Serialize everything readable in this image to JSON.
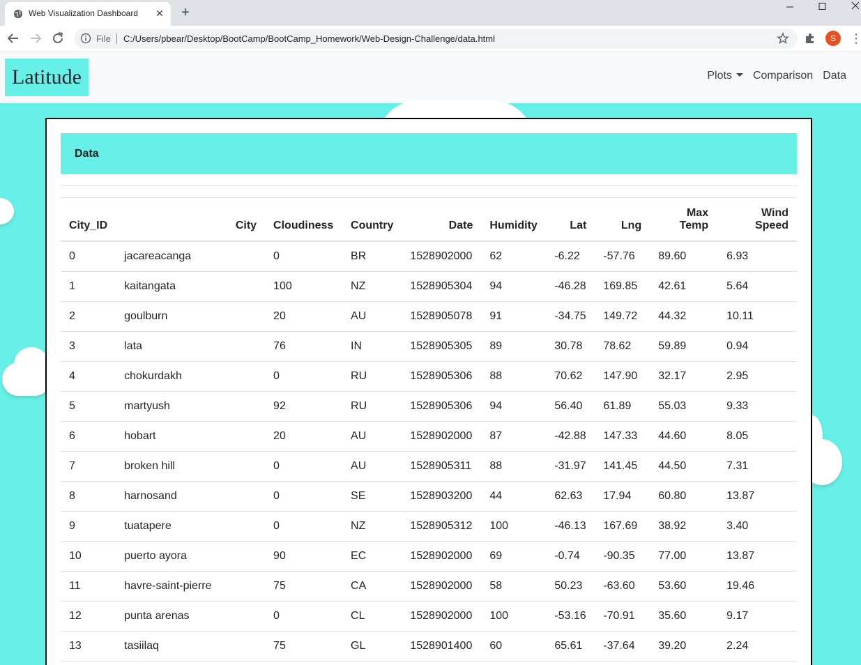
{
  "browser": {
    "tab_title": "Web Visualization Dashboard",
    "file_label": "File",
    "url": "C:/Users/pbear/Desktop/BootCamp/BootCamp_Homework/Web-Design-Challenge/data.html",
    "profile_initial": "S"
  },
  "navbar": {
    "brand": "Latitude",
    "links": [
      "Plots",
      "Comparison",
      "Data"
    ]
  },
  "panel": {
    "title": "Data"
  },
  "table": {
    "headers": [
      "City_ID",
      "City",
      "Cloudiness",
      "Country",
      "Date",
      "Humidity",
      "Lat",
      "Lng",
      "Max Temp",
      "Wind Speed"
    ],
    "rows": [
      [
        "0",
        "jacareacanga",
        "0",
        "BR",
        "1528902000",
        "62",
        "-6.22",
        "-57.76",
        "89.60",
        "6.93"
      ],
      [
        "1",
        "kaitangata",
        "100",
        "NZ",
        "1528905304",
        "94",
        "-46.28",
        "169.85",
        "42.61",
        "5.64"
      ],
      [
        "2",
        "goulburn",
        "20",
        "AU",
        "1528905078",
        "91",
        "-34.75",
        "149.72",
        "44.32",
        "10.11"
      ],
      [
        "3",
        "lata",
        "76",
        "IN",
        "1528905305",
        "89",
        "30.78",
        "78.62",
        "59.89",
        "0.94"
      ],
      [
        "4",
        "chokurdakh",
        "0",
        "RU",
        "1528905306",
        "88",
        "70.62",
        "147.90",
        "32.17",
        "2.95"
      ],
      [
        "5",
        "martyush",
        "92",
        "RU",
        "1528905306",
        "94",
        "56.40",
        "61.89",
        "55.03",
        "9.33"
      ],
      [
        "6",
        "hobart",
        "20",
        "AU",
        "1528902000",
        "87",
        "-42.88",
        "147.33",
        "44.60",
        "8.05"
      ],
      [
        "7",
        "broken hill",
        "0",
        "AU",
        "1528905311",
        "88",
        "-31.97",
        "141.45",
        "44.50",
        "7.31"
      ],
      [
        "8",
        "harnosand",
        "0",
        "SE",
        "1528903200",
        "44",
        "62.63",
        "17.94",
        "60.80",
        "13.87"
      ],
      [
        "9",
        "tuatapere",
        "0",
        "NZ",
        "1528905312",
        "100",
        "-46.13",
        "167.69",
        "38.92",
        "3.40"
      ],
      [
        "10",
        "puerto ayora",
        "90",
        "EC",
        "1528902000",
        "69",
        "-0.74",
        "-90.35",
        "77.00",
        "13.87"
      ],
      [
        "11",
        "havre-saint-pierre",
        "75",
        "CA",
        "1528902000",
        "58",
        "50.23",
        "-63.60",
        "53.60",
        "19.46"
      ],
      [
        "12",
        "punta arenas",
        "0",
        "CL",
        "1528902000",
        "100",
        "-53.16",
        "-70.91",
        "35.60",
        "9.17"
      ],
      [
        "13",
        "tasiilaq",
        "75",
        "GL",
        "1528901400",
        "60",
        "65.61",
        "-37.64",
        "39.20",
        "2.24"
      ]
    ]
  },
  "colors": {
    "page_background": "#67f0e8",
    "header_background": "#67f0e8",
    "navbar_background": "#f8f9fa"
  }
}
